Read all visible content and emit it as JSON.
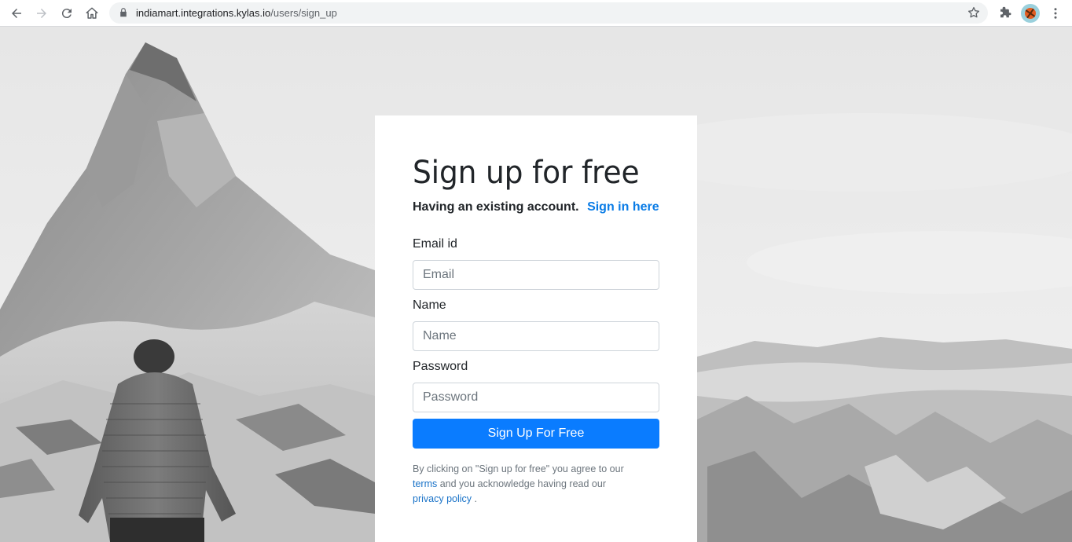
{
  "browser": {
    "url_host": "indiamart.integrations.kylas.io",
    "url_path": "/users/sign_up"
  },
  "signup": {
    "title": "Sign up for free",
    "existing_prompt": "Having an existing account.",
    "sign_in_link": "Sign in here",
    "email_label": "Email id",
    "email_placeholder": "Email",
    "name_label": "Name",
    "name_placeholder": "Name",
    "password_label": "Password",
    "password_placeholder": "Password",
    "submit_label": "Sign Up For Free",
    "legal_part1": "By clicking on \"Sign up for free\" you agree to our ",
    "terms_link": "terms",
    "legal_part2": " and you acknowledge having read our ",
    "privacy_link": "privacy policy",
    "legal_part3": " ."
  },
  "colors": {
    "primary_button": "#0a7cff",
    "link": "#0a7ce6"
  },
  "icons": [
    "back-icon",
    "forward-icon",
    "reload-icon",
    "home-icon",
    "lock-icon",
    "star-icon",
    "extensions-icon",
    "basketball-extension-icon",
    "menu-kebab-icon"
  ]
}
